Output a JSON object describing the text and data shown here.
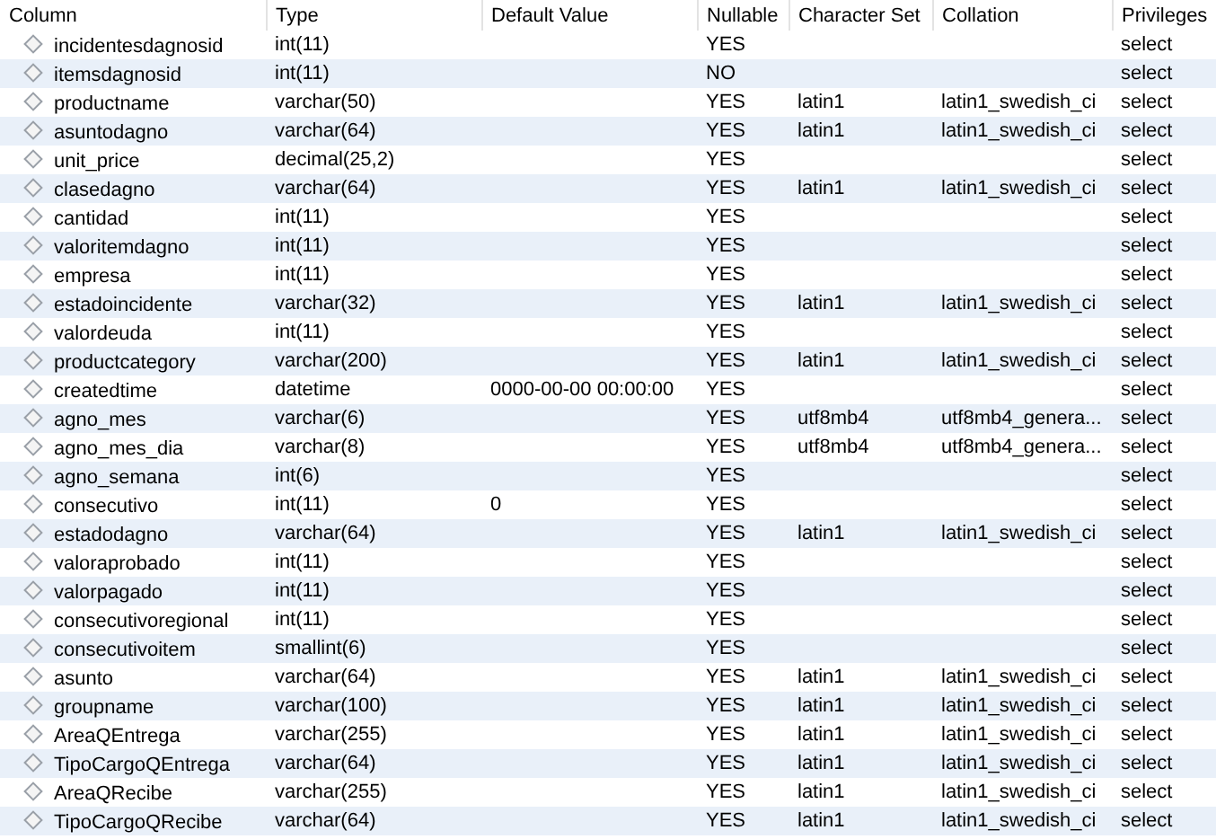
{
  "table": {
    "columns": [
      "Column",
      "Type",
      "Default Value",
      "Nullable",
      "Character Set",
      "Collation",
      "Privileges"
    ],
    "rows": [
      {
        "column": "incidentesdagnosid",
        "type": "int(11)",
        "nullable": "YES",
        "privileges": "select"
      },
      {
        "column": "itemsdagnosid",
        "type": "int(11)",
        "nullable": "NO",
        "privileges": "select"
      },
      {
        "column": "productname",
        "type": "varchar(50)",
        "nullable": "YES",
        "charset": "latin1",
        "collation": "latin1_swedish_ci",
        "privileges": "select"
      },
      {
        "column": "asuntodagno",
        "type": "varchar(64)",
        "nullable": "YES",
        "charset": "latin1",
        "collation": "latin1_swedish_ci",
        "privileges": "select"
      },
      {
        "column": "unit_price",
        "type": "decimal(25,2)",
        "nullable": "YES",
        "privileges": "select"
      },
      {
        "column": "clasedagno",
        "type": "varchar(64)",
        "nullable": "YES",
        "charset": "latin1",
        "collation": "latin1_swedish_ci",
        "privileges": "select"
      },
      {
        "column": "cantidad",
        "type": "int(11)",
        "nullable": "YES",
        "privileges": "select"
      },
      {
        "column": "valoritemdagno",
        "type": "int(11)",
        "nullable": "YES",
        "privileges": "select"
      },
      {
        "column": "empresa",
        "type": "int(11)",
        "nullable": "YES",
        "privileges": "select"
      },
      {
        "column": "estadoincidente",
        "type": "varchar(32)",
        "nullable": "YES",
        "charset": "latin1",
        "collation": "latin1_swedish_ci",
        "privileges": "select"
      },
      {
        "column": "valordeuda",
        "type": "int(11)",
        "nullable": "YES",
        "privileges": "select"
      },
      {
        "column": "productcategory",
        "type": "varchar(200)",
        "nullable": "YES",
        "charset": "latin1",
        "collation": "latin1_swedish_ci",
        "privileges": "select"
      },
      {
        "column": "createdtime",
        "type": "datetime",
        "default": "0000-00-00 00:00:00",
        "nullable": "YES",
        "privileges": "select"
      },
      {
        "column": "agno_mes",
        "type": "varchar(6)",
        "nullable": "YES",
        "charset": "utf8mb4",
        "collation": "utf8mb4_genera...",
        "privileges": "select"
      },
      {
        "column": "agno_mes_dia",
        "type": "varchar(8)",
        "nullable": "YES",
        "charset": "utf8mb4",
        "collation": "utf8mb4_genera...",
        "privileges": "select"
      },
      {
        "column": "agno_semana",
        "type": "int(6)",
        "nullable": "YES",
        "privileges": "select"
      },
      {
        "column": "consecutivo",
        "type": "int(11)",
        "default": "0",
        "nullable": "YES",
        "privileges": "select"
      },
      {
        "column": "estadodagno",
        "type": "varchar(64)",
        "nullable": "YES",
        "charset": "latin1",
        "collation": "latin1_swedish_ci",
        "privileges": "select"
      },
      {
        "column": "valoraprobado",
        "type": "int(11)",
        "nullable": "YES",
        "privileges": "select"
      },
      {
        "column": "valorpagado",
        "type": "int(11)",
        "nullable": "YES",
        "privileges": "select"
      },
      {
        "column": "consecutivoregional",
        "type": "int(11)",
        "nullable": "YES",
        "privileges": "select"
      },
      {
        "column": "consecutivoitem",
        "type": "smallint(6)",
        "nullable": "YES",
        "privileges": "select"
      },
      {
        "column": "asunto",
        "type": "varchar(64)",
        "nullable": "YES",
        "charset": "latin1",
        "collation": "latin1_swedish_ci",
        "privileges": "select"
      },
      {
        "column": "groupname",
        "type": "varchar(100)",
        "nullable": "YES",
        "charset": "latin1",
        "collation": "latin1_swedish_ci",
        "privileges": "select"
      },
      {
        "column": "AreaQEntrega",
        "type": "varchar(255)",
        "nullable": "YES",
        "charset": "latin1",
        "collation": "latin1_swedish_ci",
        "privileges": "select"
      },
      {
        "column": "TipoCargoQEntrega",
        "type": "varchar(64)",
        "nullable": "YES",
        "charset": "latin1",
        "collation": "latin1_swedish_ci",
        "privileges": "select"
      },
      {
        "column": "AreaQRecibe",
        "type": "varchar(255)",
        "nullable": "YES",
        "charset": "latin1",
        "collation": "latin1_swedish_ci",
        "privileges": "select"
      },
      {
        "column": "TipoCargoQRecibe",
        "type": "varchar(64)",
        "nullable": "YES",
        "charset": "latin1",
        "collation": "latin1_swedish_ci",
        "privileges": "select"
      }
    ]
  }
}
